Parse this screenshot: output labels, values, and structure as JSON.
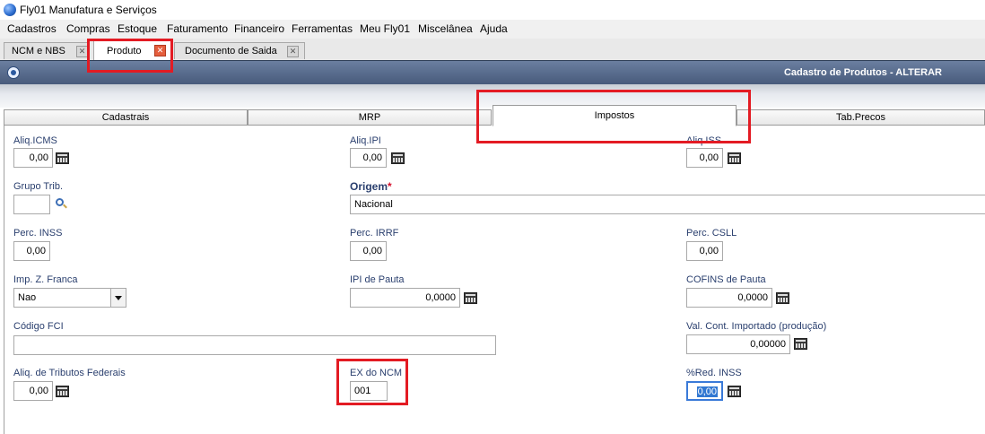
{
  "window": {
    "title": "Fly01 Manufatura e Serviços"
  },
  "menu": [
    "Cadastros",
    "Compras",
    "Estoque",
    "Faturamento",
    "Financeiro",
    "Ferramentas",
    "Meu Fly01",
    "Miscelânea",
    "Ajuda"
  ],
  "doc_tabs": [
    {
      "label": "NCM e NBS"
    },
    {
      "label": "Produto"
    },
    {
      "label": "Documento de Saida"
    }
  ],
  "form": {
    "title": "Cadastro de Produtos - ALTERAR"
  },
  "sub_tabs": [
    "Cadastrais",
    "MRP",
    "Impostos",
    "Tab.Precos"
  ],
  "fields": {
    "aliq_icms": {
      "label": "Aliq.ICMS",
      "value": "0,00"
    },
    "aliq_ipi": {
      "label": "Aliq.IPI",
      "value": "0,00"
    },
    "aliq_iss": {
      "label": "Aliq.ISS",
      "value": "0,00"
    },
    "grupo_trib": {
      "label": "Grupo Trib.",
      "value": ""
    },
    "origem": {
      "label": "Origem",
      "required_mark": "*",
      "value": "Nacional"
    },
    "perc_inss": {
      "label": "Perc. INSS",
      "value": "0,00"
    },
    "perc_irrf": {
      "label": "Perc. IRRF",
      "value": "0,00"
    },
    "perc_csll": {
      "label": "Perc. CSLL",
      "value": "0,00"
    },
    "imp_z_franca": {
      "label": "Imp. Z. Franca",
      "value": "Nao"
    },
    "ipi_pauta": {
      "label": "IPI de Pauta",
      "value": "0,0000"
    },
    "cofins_pauta": {
      "label": "COFINS de Pauta",
      "value": "0,0000"
    },
    "codigo_fci": {
      "label": "Código FCI",
      "value": ""
    },
    "val_cont_importado": {
      "label": "Val. Cont. Importado (produção)",
      "value": "0,00000"
    },
    "aliq_trib_federais": {
      "label": "Aliq. de Tributos Federais",
      "value": "0,00"
    },
    "ex_ncm": {
      "label": "EX do NCM",
      "value": "001"
    },
    "red_inss": {
      "label": "%Red. INSS",
      "value": "0,00"
    }
  },
  "colors": {
    "highlight": "#e31b23",
    "label_blue": "#2a3f6e",
    "header_bg": "#46597a"
  }
}
